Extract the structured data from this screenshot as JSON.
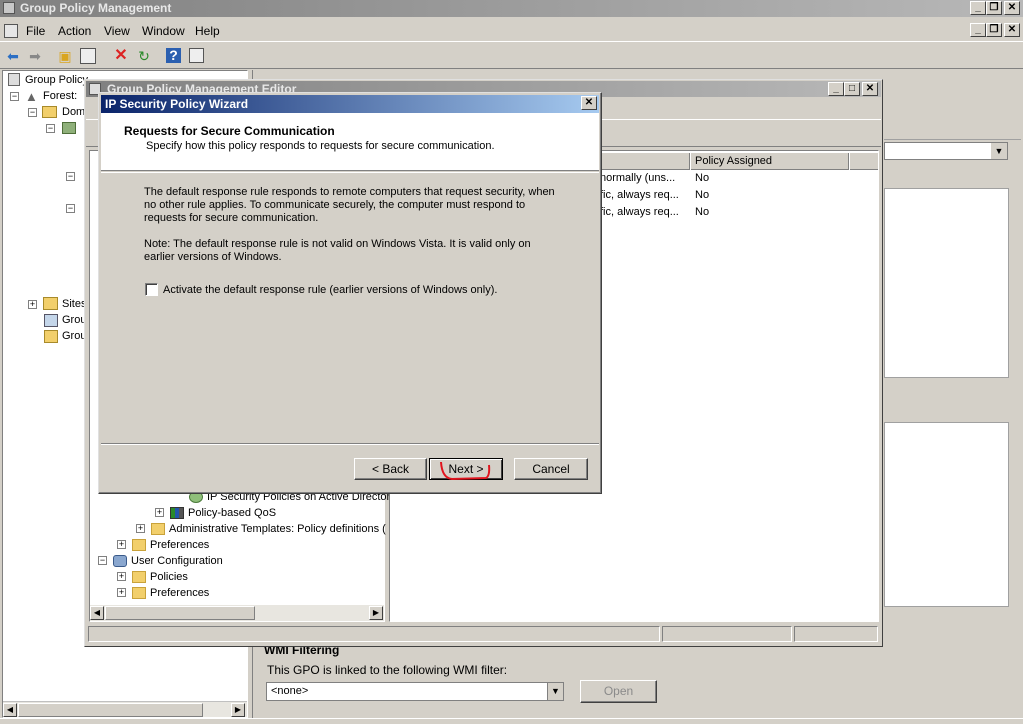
{
  "main_window": {
    "title": "Group Policy Management",
    "menu": [
      "File",
      "Action",
      "View",
      "Window",
      "Help"
    ],
    "toolbar_icons": [
      "back-icon",
      "forward-icon",
      "up-folder-icon",
      "show-hide-tree-icon",
      "delete-icon",
      "refresh-icon",
      "help-icon",
      "properties-icon"
    ],
    "tree": {
      "root": "Group Policy",
      "forest": "Forest:",
      "domains": "Dom",
      "sites": "Sites",
      "item_a": "Grou",
      "item_b": "Grou"
    },
    "wmi": {
      "heading": "WMI Filtering",
      "label": "This GPO is linked to the following WMI filter:",
      "select_value": "<none>",
      "open_button": "Open"
    }
  },
  "editor_window": {
    "title": "Group Policy Management Editor",
    "tree": [
      {
        "label": "IP Security Policies on Active Director",
        "indent": 4,
        "expander": false,
        "icon": "shield-icon"
      },
      {
        "label": "Policy-based QoS",
        "indent": 3,
        "expander": true,
        "icon": "qos-chart-icon"
      },
      {
        "label": "Administrative Templates: Policy definitions (",
        "indent": 2,
        "expander": true,
        "icon": "folder-icon"
      },
      {
        "label": "Preferences",
        "indent": 1,
        "expander": true,
        "icon": "folder-icon"
      },
      {
        "label": "User Configuration",
        "indent": 0,
        "expander": true,
        "icon": "user-config-icon",
        "open": true
      },
      {
        "label": "Policies",
        "indent": 1,
        "expander": true,
        "icon": "folder-icon"
      },
      {
        "label": "Preferences",
        "indent": 1,
        "expander": true,
        "icon": "folder-icon"
      }
    ],
    "list": {
      "header": "Policy Assigned",
      "rows": [
        {
          "desc": "normally (uns...",
          "assigned": "No"
        },
        {
          "desc": "fic, always req...",
          "assigned": "No"
        },
        {
          "desc": "fic, always req...",
          "assigned": "No"
        }
      ]
    }
  },
  "wizard": {
    "title": "IP Security Policy Wizard",
    "heading": "Requests for Secure Communication",
    "subheading": "Specify how this policy responds to requests for secure communication.",
    "paragraph1": "The default response rule responds to remote computers that request security, when no other rule applies. To communicate securely, the computer must respond to requests for secure communication.",
    "paragraph2": "Note: The default response rule is not valid on Windows Vista.  It is valid only on earlier versions of Windows.",
    "checkbox_label": "Activate the default response rule (earlier versions of Windows only).",
    "checkbox_checked": false,
    "back_button": "< Back",
    "next_button": "Next >",
    "cancel_button": "Cancel",
    "close_glyph": "✕"
  }
}
